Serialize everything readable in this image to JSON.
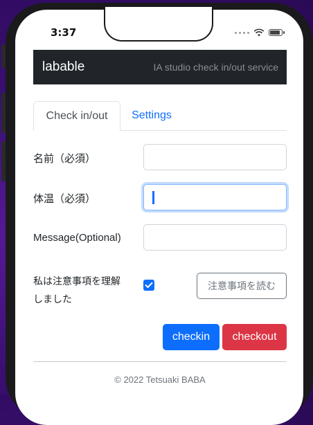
{
  "status_bar": {
    "time": "3:37"
  },
  "navbar": {
    "brand": "labable",
    "subtitle": "IA studio check in/out service"
  },
  "tabs": [
    {
      "label": "Check in/out",
      "active": true
    },
    {
      "label": "Settings",
      "active": false
    }
  ],
  "form": {
    "name_label": "名前（必須）",
    "name_value": "",
    "temp_label": "体温（必須）",
    "temp_value": "",
    "message_label": "Message(Optional)",
    "message_value": "",
    "agree_label_line1": "私は注意事項を理解",
    "agree_label_line2": "しました",
    "agree_checked": true,
    "read_notice_button": "注意事項を読む"
  },
  "actions": {
    "checkin_label": "checkin",
    "checkout_label": "checkout"
  },
  "footer": {
    "copyright": "© 2022 Tetsuaki BABA"
  },
  "colors": {
    "navbar_bg": "#212529",
    "primary": "#0d6efd",
    "danger": "#dc3545",
    "secondary": "#6c757d"
  }
}
